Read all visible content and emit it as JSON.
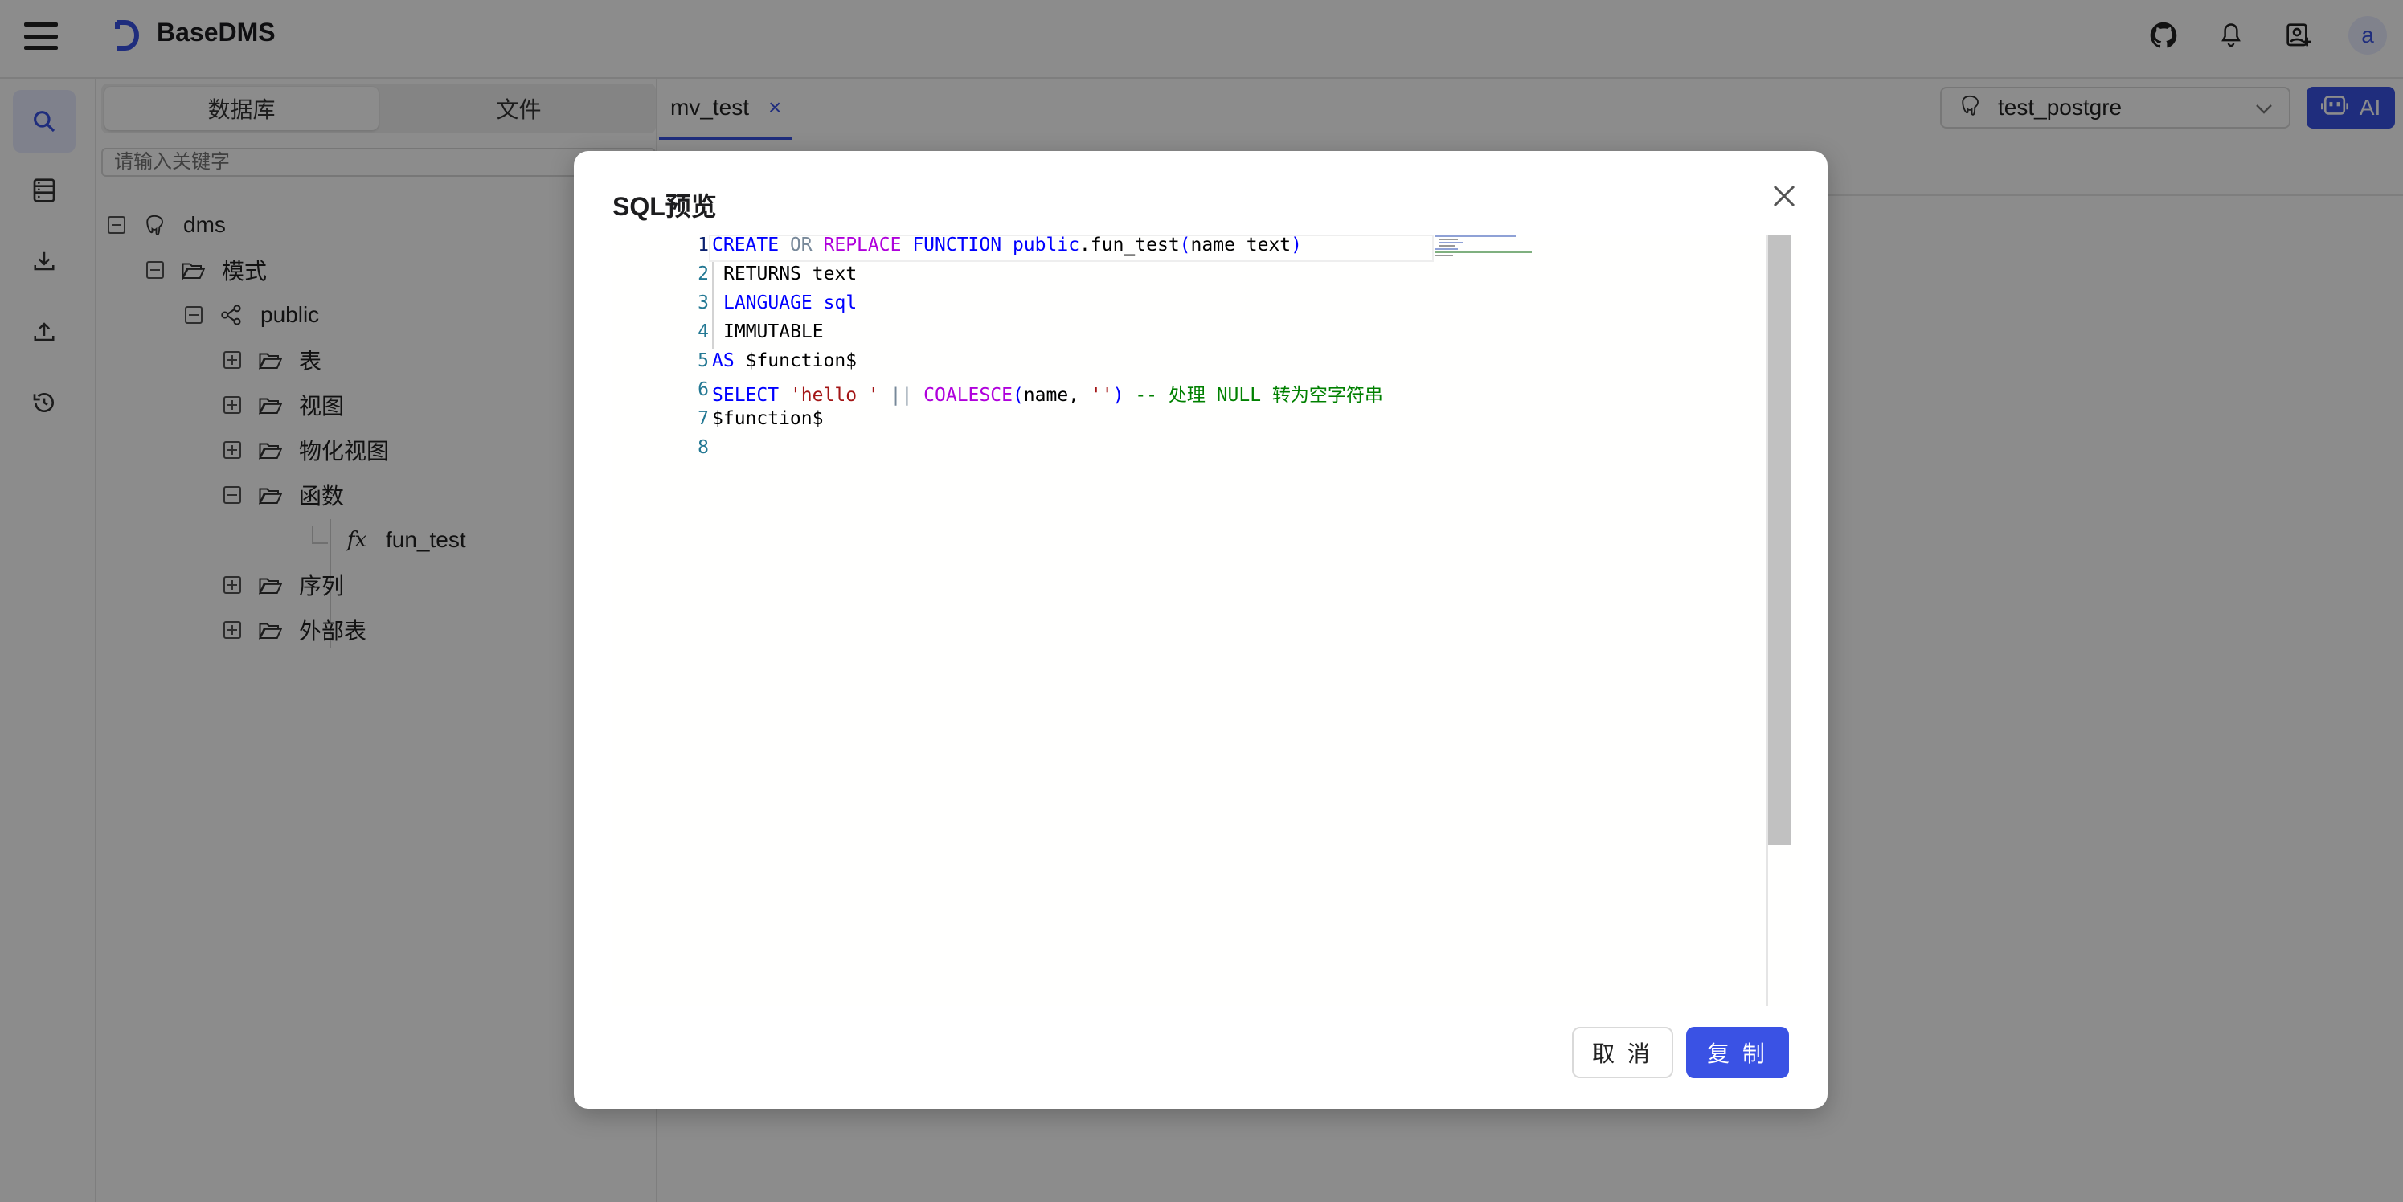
{
  "app": {
    "title": "BaseDMS",
    "avatar_letter": "a",
    "accent_color": "#3a52e4"
  },
  "top_icons": [
    "github-icon",
    "bell-icon",
    "user-add-icon"
  ],
  "rail": {
    "items": [
      "search-icon",
      "database-icon",
      "download-icon",
      "upload-icon",
      "history-icon"
    ]
  },
  "sidepanel": {
    "segments": [
      "数据库",
      "文件"
    ],
    "search_placeholder": "请输入关键字",
    "tree": [
      {
        "label": "dms",
        "icon": "postgres-icon",
        "expander": "minus"
      },
      {
        "label": "模式",
        "icon": "folder-open-icon",
        "expander": "minus"
      },
      {
        "label": "public",
        "icon": "schema-icon",
        "expander": "minus"
      },
      {
        "label": "表",
        "icon": "folder-icon",
        "expander": "plus"
      },
      {
        "label": "视图",
        "icon": "folder-icon",
        "expander": "plus"
      },
      {
        "label": "物化视图",
        "icon": "folder-icon",
        "expander": "plus"
      },
      {
        "label": "函数",
        "icon": "folder-open-icon",
        "expander": "minus"
      },
      {
        "label": "fun_test",
        "icon": "function-icon",
        "glyph": "fx"
      },
      {
        "label": "序列",
        "icon": "folder-icon",
        "expander": "plus"
      },
      {
        "label": "外部表",
        "icon": "folder-icon",
        "expander": "plus"
      }
    ]
  },
  "main": {
    "tab_label": "mv_test",
    "tab_close": "×",
    "db_selected": "test_postgre",
    "ai_label": "AI"
  },
  "modal": {
    "title": "SQL预览",
    "line_numbers": [
      "1",
      "2",
      "3",
      "4",
      "5",
      "6",
      "7",
      "8"
    ],
    "cancel_label": "取 消",
    "copy_label": "复 制",
    "code_tokens": {
      "create": "CREATE",
      "or": "OR",
      "replace": "REPLACE",
      "function": "FUNCTION",
      "public": "public",
      "fname": ".fun_test",
      "lparen": "(",
      "args": "name text",
      "rparen": ")",
      "returns": "RETURNS text",
      "language": "LANGUAGE",
      "sql": "sql",
      "immutable": "IMMUTABLE",
      "as": "AS",
      "dollar": " $function$",
      "select": "SELECT",
      "hello": "'hello '",
      "concat": "||",
      "coalesce": "COALESCE",
      "name_arg": "name, ",
      "empty": "''",
      "comment": "-- 处理 NULL 转为空字符串",
      "end": "$function$"
    }
  }
}
